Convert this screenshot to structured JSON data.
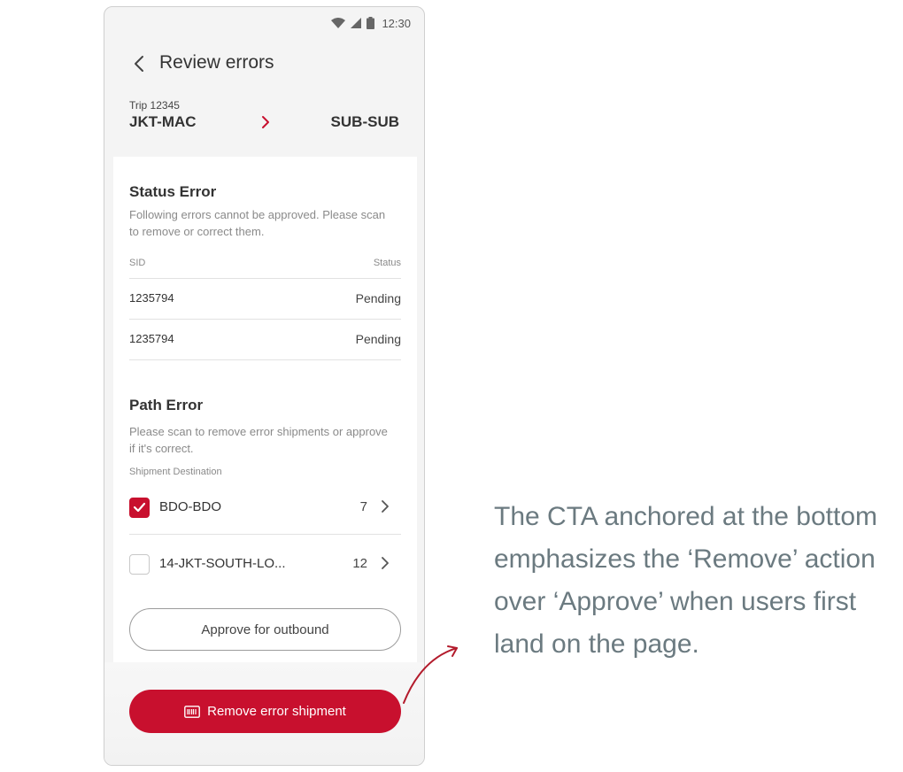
{
  "status_bar": {
    "time": "12:30"
  },
  "header": {
    "title": "Review errors"
  },
  "trip": {
    "label": "Trip 12345",
    "origin": "JKT-MAC",
    "destination": "SUB-SUB"
  },
  "status_error": {
    "title": "Status Error",
    "description": "Following errors cannot be approved. Please scan to remove or correct them.",
    "columns": {
      "sid": "SID",
      "status": "Status"
    },
    "rows": [
      {
        "sid": "1235794",
        "status": "Pending"
      },
      {
        "sid": "1235794",
        "status": "Pending"
      }
    ]
  },
  "path_error": {
    "title": "Path Error",
    "description": "Please scan to remove error shipments or approve if it's correct.",
    "subheading": "Shipment Destination",
    "destinations": [
      {
        "label": "BDO-BDO",
        "count": "7",
        "checked": true
      },
      {
        "label": "14-JKT-SOUTH-LO...",
        "count": "12",
        "checked": false
      }
    ],
    "approve_label": "Approve for outbound"
  },
  "cta": {
    "label": "Remove error shipment"
  },
  "annotation": {
    "text": "The CTA anchored at the bottom emphasizes the ‘Remove’ action over ‘Approve’ when users first land on the page."
  },
  "colors": {
    "accent": "#c8102e",
    "annotation_text": "#6b7a80"
  }
}
